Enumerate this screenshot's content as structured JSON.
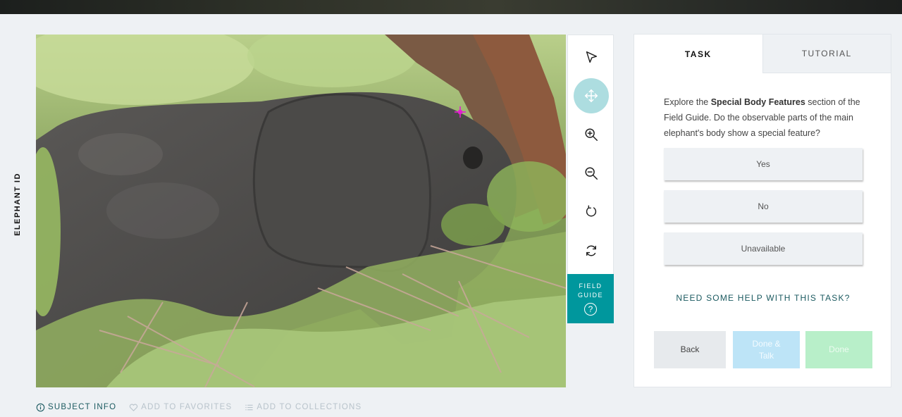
{
  "project": {
    "title": "ELEPHANT ID"
  },
  "subject": {
    "image_alt": "elephant"
  },
  "toolbar": {
    "tools": [
      {
        "name": "annotate",
        "icon": "pointer-arrow-icon",
        "active": false
      },
      {
        "name": "move",
        "icon": "move-arrows-icon",
        "active": true
      },
      {
        "name": "zoom-in",
        "icon": "zoom-in-icon",
        "active": false
      },
      {
        "name": "zoom-out",
        "icon": "zoom-out-icon",
        "active": false
      },
      {
        "name": "rotate",
        "icon": "rotate-icon",
        "active": false
      },
      {
        "name": "reset",
        "icon": "reset-icon",
        "active": false
      }
    ],
    "field_guide_label": "FIELD GUIDE",
    "field_guide_help": "?"
  },
  "tabs": {
    "task": "TASK",
    "tutorial": "TUTORIAL"
  },
  "task": {
    "question_pre": "Explore the ",
    "question_bold": "Special Body Features",
    "question_post": " section of the Field Guide. Do the observable parts of the main elephant's body show a special feature?",
    "answers": [
      "Yes",
      "No",
      "Unavailable"
    ],
    "help": "NEED SOME HELP WITH THIS TASK?",
    "back": "Back",
    "done_talk": "Done & Talk",
    "done": "Done"
  },
  "meta": {
    "subject_info": "SUBJECT INFO",
    "favorites": "ADD TO FAVORITES",
    "collections": "ADD TO COLLECTIONS"
  },
  "colors": {
    "accent": "#00979d",
    "link": "#1b5a60",
    "active_tool": "#addde0",
    "done_talk_bg": "#bde4f7",
    "done_bg": "#b8efc9"
  }
}
